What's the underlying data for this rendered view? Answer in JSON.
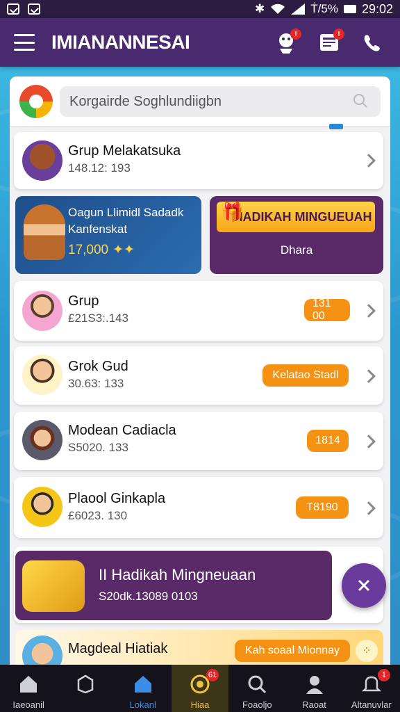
{
  "status_bar": {
    "battery": "Ṫ/5%",
    "time": "29:02"
  },
  "header": {
    "title": "IMIANANNESAI",
    "icons": [
      "mascot-icon",
      "news-icon",
      "phone-icon"
    ],
    "badges": [
      "!",
      "!",
      ""
    ]
  },
  "search": {
    "placeholder": "Korgairde Soghlundiigbn"
  },
  "rows": [
    {
      "title": "Grup Melakatsuka",
      "sub": "148.12: 193",
      "pill": ""
    },
    {
      "title": "Grup",
      "sub": "£21S3:.143",
      "pill": "131 00"
    },
    {
      "title": "Grok Gud",
      "sub": "30.63: 133",
      "pill": "Kelatao Stadl"
    },
    {
      "title": "Modean Cadiacla",
      "sub": "S5020. 133",
      "pill": "1814"
    },
    {
      "title": "Plaool Ginkapla",
      "sub": "£6023. 130",
      "pill": "T8190"
    },
    {
      "title": "Magdeal Hiatiak",
      "sub": "",
      "pill": "Kah soaal  Mionnay"
    }
  ],
  "promo_left": {
    "title_line1": "Oagun Llimidl Sadadk",
    "title_line2": "Kanfenskat",
    "amount": "17,000"
  },
  "promo_right": {
    "banner": "HADIKAH MINGUEUAH",
    "label": "Dhara"
  },
  "purple_banner": {
    "title": "II Hadikah Mingneuaan",
    "sub": "S20dk.13089 0103"
  },
  "bottom_nav": [
    {
      "label": "Iaeoanil",
      "icon": "home-icon"
    },
    {
      "label": "",
      "icon": "box-icon"
    },
    {
      "label": "Lokanl",
      "icon": "home-active-icon"
    },
    {
      "label": "Hiaa",
      "icon": "coin-icon",
      "badge": "61"
    },
    {
      "label": "Foaoljo",
      "icon": "search-icon"
    },
    {
      "label": "Raoat",
      "icon": "profile-icon"
    },
    {
      "label": "Altanuvlar",
      "icon": "notify-icon",
      "badge": "1"
    }
  ],
  "colors": {
    "header": "#4a2a6e",
    "accent": "#f59214",
    "nav": "#14121a",
    "purple": "#5a2a68"
  }
}
